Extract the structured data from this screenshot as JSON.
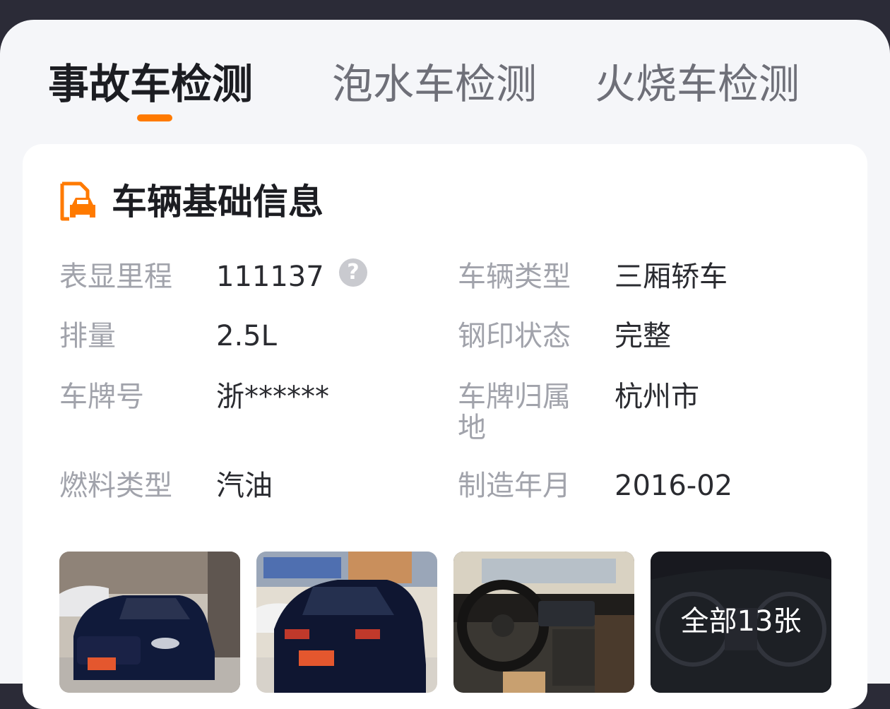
{
  "tabs": [
    {
      "label": "事故车检测",
      "active": true
    },
    {
      "label": "泡水车检测",
      "active": false
    },
    {
      "label": "火烧车检测",
      "active": false
    }
  ],
  "accent_color": "#ff7a00",
  "card": {
    "icon": "vehicle-document-icon",
    "title": "车辆基础信息",
    "fields": {
      "mileage": {
        "label": "表显里程",
        "value": "111137"
      },
      "body_type": {
        "label": "车辆类型",
        "value": "三厢轿车"
      },
      "displacement": {
        "label": "排量",
        "value": "2.5L"
      },
      "stamp_status": {
        "label": "钢印状态",
        "value": "完整"
      },
      "plate": {
        "label": "车牌号",
        "value": "浙******"
      },
      "plate_region": {
        "label": "车牌归属地",
        "value": "杭州市"
      },
      "fuel": {
        "label": "燃料类型",
        "value": "汽油"
      },
      "manufacture_date": {
        "label": "制造年月",
        "value": "2016-02"
      }
    },
    "help_icon": "question-circle-icon",
    "photos": {
      "all_label": "全部13张"
    }
  }
}
